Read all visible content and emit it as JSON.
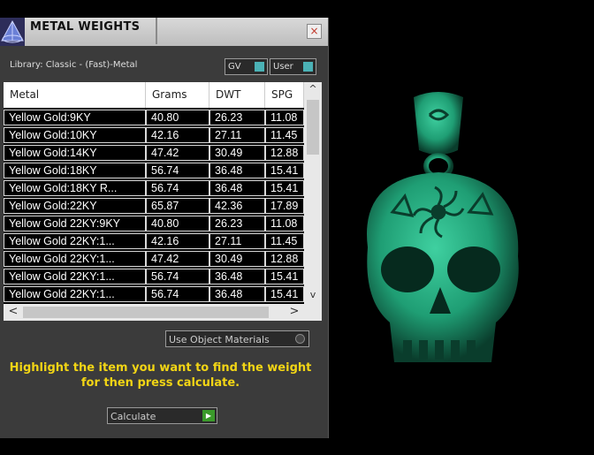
{
  "window": {
    "title": "METAL WEIGHTS",
    "close_glyph": "×"
  },
  "library": {
    "label": "Library: Classic - (Fast)-Metal",
    "gv_label": "GV",
    "user_label": "User"
  },
  "table": {
    "headers": [
      "Metal",
      "Grams",
      "DWT",
      "SPG"
    ],
    "rows": [
      [
        "Yellow Gold:9KY",
        "40.80",
        "26.23",
        "11.08"
      ],
      [
        "Yellow Gold:10KY",
        "42.16",
        "27.11",
        "11.45"
      ],
      [
        "Yellow Gold:14KY",
        "47.42",
        "30.49",
        "12.88"
      ],
      [
        "Yellow Gold:18KY",
        "56.74",
        "36.48",
        "15.41"
      ],
      [
        "Yellow Gold:18KY R...",
        "56.74",
        "36.48",
        "15.41"
      ],
      [
        "Yellow Gold:22KY",
        "65.87",
        "42.36",
        "17.89"
      ],
      [
        "Yellow Gold 22KY:9KY",
        "40.80",
        "26.23",
        "11.08"
      ],
      [
        "Yellow Gold 22KY:1...",
        "42.16",
        "27.11",
        "11.45"
      ],
      [
        "Yellow Gold 22KY:1...",
        "47.42",
        "30.49",
        "12.88"
      ],
      [
        "Yellow Gold 22KY:1...",
        "56.74",
        "36.48",
        "15.41"
      ],
      [
        "Yellow Gold 22KY:1...",
        "56.74",
        "36.48",
        "15.41"
      ]
    ],
    "scroll_up": "^",
    "scroll_down": "v",
    "scroll_left": "<",
    "scroll_right": ">"
  },
  "options": {
    "use_object_materials": "Use Object Materials"
  },
  "instruction": "Highlight the item you want to find the weight for then press calculate.",
  "calculate": {
    "label": "Calculate",
    "go_glyph": "▶"
  },
  "colors": {
    "panel_bg": "#3b3b3b",
    "accent_teal": "#4bb2b6",
    "instruction_yellow": "#f2d515",
    "model_green": "#1f9e74"
  },
  "icons": {
    "logo": "pyramid-logo-icon",
    "close": "close-icon",
    "calculate_go": "play-arrow-icon"
  }
}
